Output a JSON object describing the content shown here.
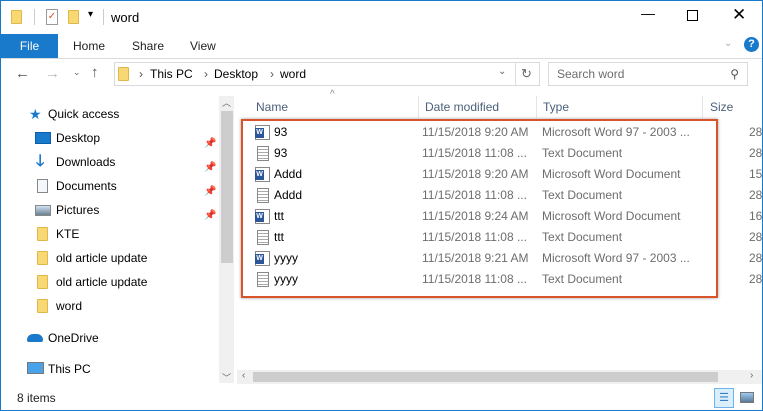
{
  "window": {
    "title": "word",
    "accent": "#1979ca"
  },
  "ribbon": {
    "tabs": [
      "File",
      "Home",
      "Share",
      "View"
    ]
  },
  "address": {
    "path": [
      "This PC",
      "Desktop",
      "word"
    ]
  },
  "search": {
    "placeholder": "Search word"
  },
  "nav": {
    "quick_access": "Quick access",
    "items": [
      {
        "label": "Desktop",
        "icon": "desktop-icon",
        "pinned": true
      },
      {
        "label": "Downloads",
        "icon": "download-icon",
        "pinned": true
      },
      {
        "label": "Documents",
        "icon": "documents-icon",
        "pinned": true
      },
      {
        "label": "Pictures",
        "icon": "pictures-icon",
        "pinned": true
      },
      {
        "label": "KTE",
        "icon": "folder-icon",
        "pinned": false
      },
      {
        "label": "old article update",
        "icon": "folder-icon",
        "pinned": false
      },
      {
        "label": "old article update",
        "icon": "folder-icon",
        "pinned": false
      },
      {
        "label": "word",
        "icon": "folder-icon",
        "pinned": false
      }
    ],
    "onedrive": "OneDrive",
    "thispc": "This PC"
  },
  "columns": [
    "Name",
    "Date modified",
    "Type",
    "Size"
  ],
  "files": [
    {
      "name": "93",
      "date": "11/15/2018 9:20 AM",
      "type": "Microsoft Word 97 - 2003 ...",
      "size": "28",
      "icon": "word-icon"
    },
    {
      "name": "93",
      "date": "11/15/2018 11:08 ...",
      "type": "Text Document",
      "size": "28",
      "icon": "text-file-icon"
    },
    {
      "name": "Addd",
      "date": "11/15/2018 9:20 AM",
      "type": "Microsoft Word Document",
      "size": "15",
      "icon": "word-icon"
    },
    {
      "name": "Addd",
      "date": "11/15/2018 11:08 ...",
      "type": "Text Document",
      "size": "28",
      "icon": "text-file-icon"
    },
    {
      "name": "ttt",
      "date": "11/15/2018 9:24 AM",
      "type": "Microsoft Word Document",
      "size": "16",
      "icon": "word-icon"
    },
    {
      "name": "ttt",
      "date": "11/15/2018 11:08 ...",
      "type": "Text Document",
      "size": "28",
      "icon": "text-file-icon"
    },
    {
      "name": "yyyy",
      "date": "11/15/2018 9:21 AM",
      "type": "Microsoft Word 97 - 2003 ...",
      "size": "28",
      "icon": "word-icon"
    },
    {
      "name": "yyyy",
      "date": "11/15/2018 11:08 ...",
      "type": "Text Document",
      "size": "28",
      "icon": "text-file-icon"
    }
  ],
  "status": {
    "count": "8 items"
  }
}
